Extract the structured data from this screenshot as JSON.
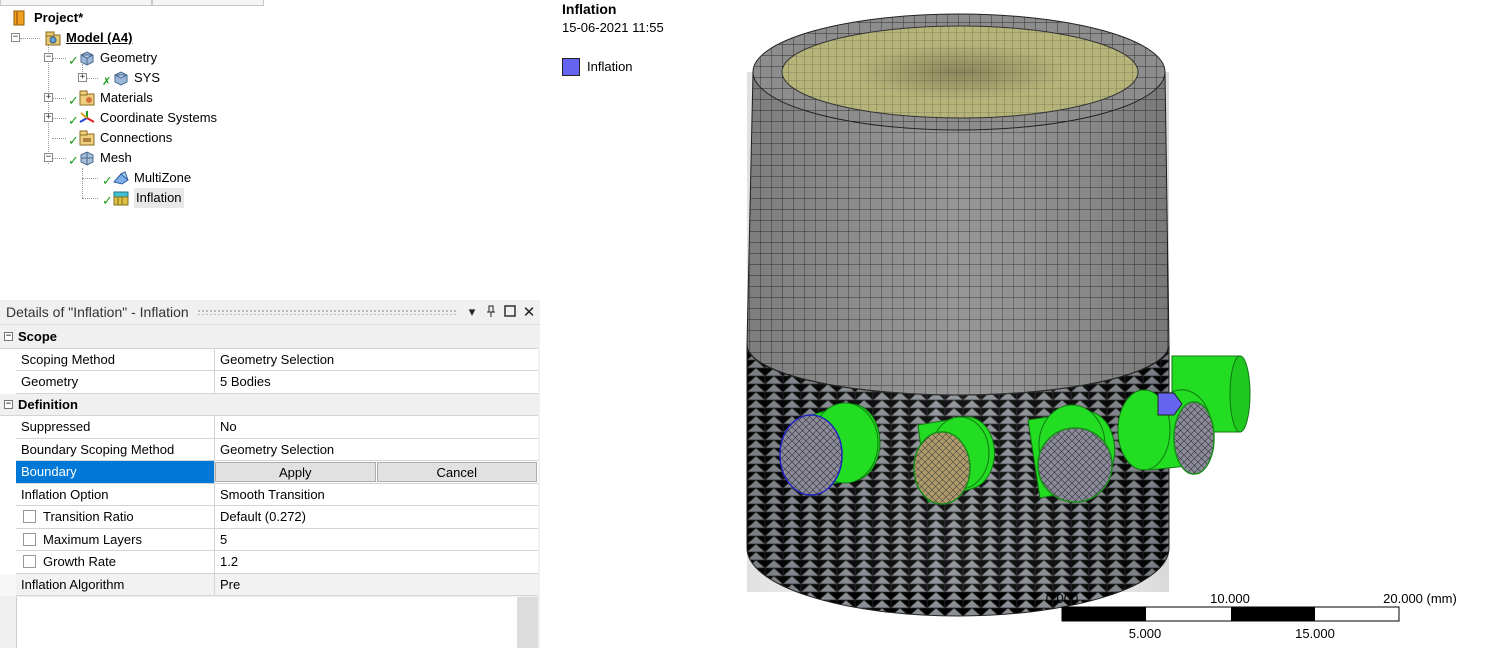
{
  "tree": {
    "project": "Project*",
    "model": "Model (A4)",
    "geometry": "Geometry",
    "sys": "SYS",
    "materials": "Materials",
    "coordinate_systems": "Coordinate Systems",
    "connections": "Connections",
    "mesh": "Mesh",
    "multizone": "MultiZone",
    "inflation": "Inflation"
  },
  "details": {
    "title": "Details of \"Inflation\" - Inflation",
    "sections": {
      "scope": "Scope",
      "definition": "Definition"
    },
    "rows": {
      "scoping_method": {
        "label": "Scoping Method",
        "value": "Geometry Selection"
      },
      "geometry": {
        "label": "Geometry",
        "value": "5 Bodies"
      },
      "suppressed": {
        "label": "Suppressed",
        "value": "No"
      },
      "boundary_scoping_method": {
        "label": "Boundary Scoping Method",
        "value": "Geometry Selection"
      },
      "boundary": {
        "label": "Boundary",
        "apply": "Apply",
        "cancel": "Cancel"
      },
      "inflation_option": {
        "label": "Inflation Option",
        "value": "Smooth Transition"
      },
      "transition_ratio": {
        "label": "Transition Ratio",
        "value": "Default (0.272)"
      },
      "maximum_layers": {
        "label": "Maximum Layers",
        "value": "5"
      },
      "growth_rate": {
        "label": "Growth Rate",
        "value": "1.2"
      },
      "inflation_algorithm": {
        "label": "Inflation Algorithm",
        "value": "Pre"
      }
    }
  },
  "graphics": {
    "title": "Inflation",
    "date": "15-06-2021 11:55",
    "legend_label": "Inflation",
    "legend_color": "#6464f0",
    "scale": {
      "top_labels": [
        "0.000",
        "10.000",
        "20.000 (mm)"
      ],
      "bottom_labels": [
        "5.000",
        "15.000"
      ]
    }
  },
  "colors": {
    "selection": "#0078d7",
    "mesh_grey": "#8c8c8c",
    "cap_olive": "#b4b478",
    "pipe_green": "#22dd22"
  }
}
